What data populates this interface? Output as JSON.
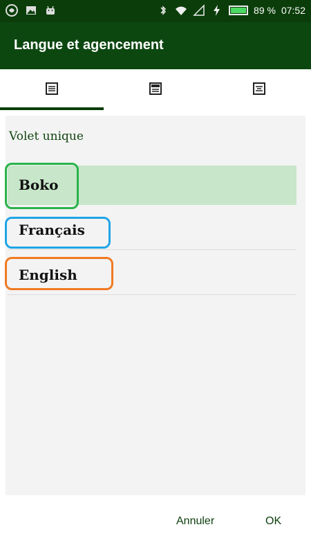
{
  "status_bar": {
    "battery": "89 %",
    "time": "07:52",
    "left_icons": [
      "app-logo-icon",
      "image-icon",
      "android-icon"
    ],
    "right_icons": [
      "bluetooth-icon",
      "wifi-icon",
      "signal-icon",
      "charging-icon",
      "battery-icon"
    ]
  },
  "header": {
    "title": "Langue et agencement"
  },
  "tabs": [
    {
      "icon": "single-pane-layout-icon",
      "selected": true
    },
    {
      "icon": "split-layout-icon",
      "selected": false
    },
    {
      "icon": "list-layout-icon",
      "selected": false
    }
  ],
  "section": {
    "title": "Volet unique"
  },
  "languages": [
    {
      "label": "Boko",
      "selected": true,
      "outline_color": "#29b34a"
    },
    {
      "label": "Français",
      "selected": false,
      "outline_color": "#1fa5e8"
    },
    {
      "label": "English",
      "selected": false,
      "outline_color": "#f07a22"
    }
  ],
  "footer": {
    "cancel_label": "Annuler",
    "ok_label": "OK"
  },
  "colors": {
    "primary": "#0d4710",
    "status": "#0a3d0a",
    "selected_bg": "#c8e6c9"
  }
}
